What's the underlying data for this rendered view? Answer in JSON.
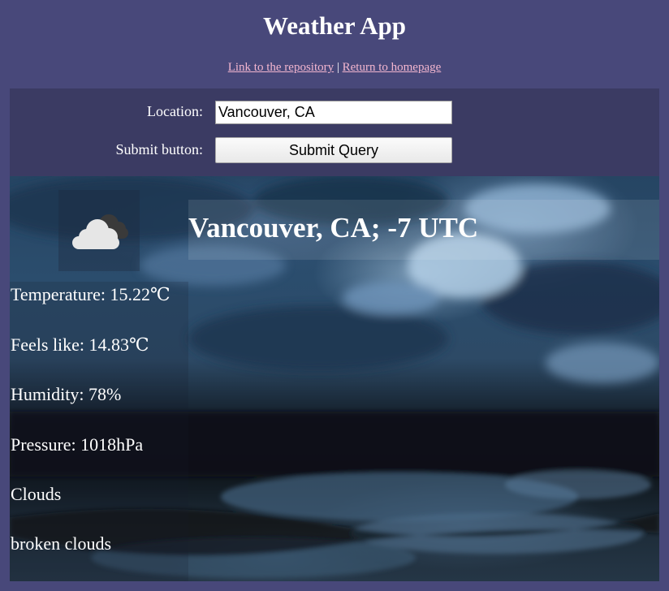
{
  "header": {
    "title": "Weather App",
    "repo_link": "Link to the repository",
    "separator": "|",
    "home_link": "Return to homepage"
  },
  "form": {
    "location_label": "Location:",
    "location_value": "Vancouver, CA",
    "submit_label": "Submit button:",
    "submit_button": "Submit Query"
  },
  "weather": {
    "icon": "broken-clouds-icon",
    "heading": "Vancouver, CA; -7 UTC",
    "temperature": "Temperature: 15.22℃",
    "feels_like": "Feels like: 14.83℃",
    "humidity": "Humidity: 78%",
    "pressure": "Pressure: 1018hPa",
    "condition": "Clouds",
    "description": "broken clouds"
  },
  "colors": {
    "page_background": "#48487a",
    "form_background": "#3b3b63",
    "link": "#f3b6cf",
    "text": "#ffffff"
  }
}
